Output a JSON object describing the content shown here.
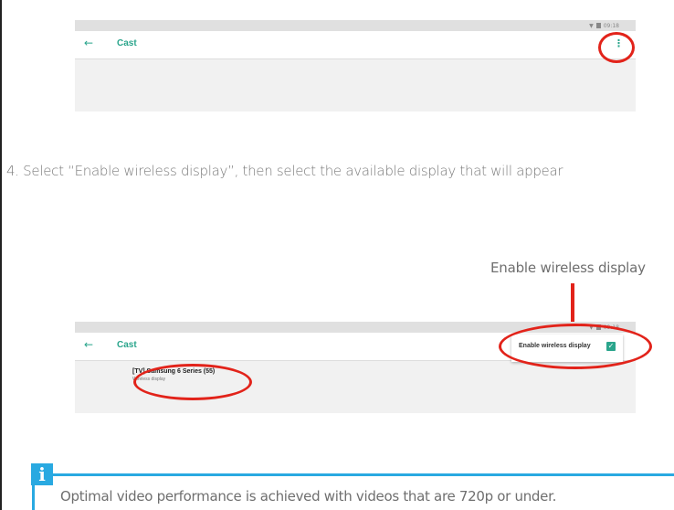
{
  "screenshot1": {
    "status_time": "09:18",
    "back_glyph": "←",
    "title": "Cast",
    "menu_glyph": "⋮"
  },
  "step_text": "4. Select “Enable wireless display”, then select the available display that will appear",
  "callout": {
    "label": "Enable wireless display"
  },
  "screenshot2": {
    "status_time": "09:18",
    "back_glyph": "←",
    "title": "Cast",
    "menu_label": "Enable wireless display",
    "checkbox_glyph": "✓",
    "device_name": "[TV] Samsung 6 Series (55)",
    "device_sub": "Wireless display"
  },
  "note": {
    "badge": "i",
    "text": "Optimal video performance is achieved with videos that are 720p or under."
  },
  "colors": {
    "accent": "#2aa58c",
    "highlight": "#e2231a",
    "info": "#29a9e1"
  }
}
